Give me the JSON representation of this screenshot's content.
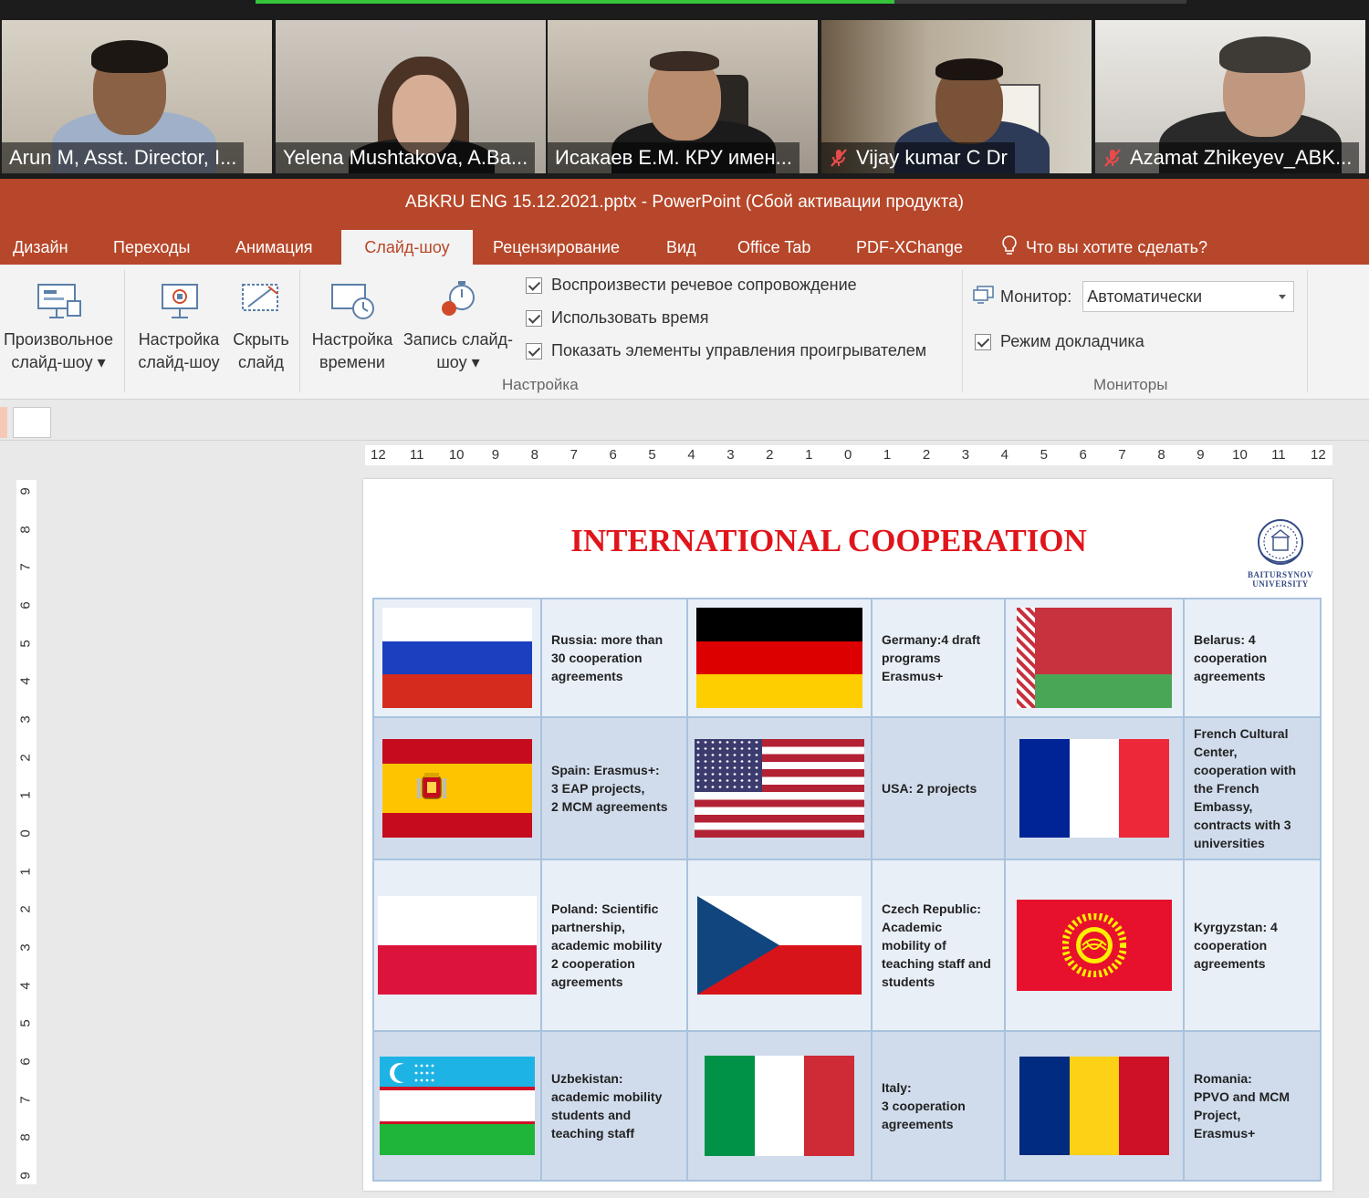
{
  "meeting": {
    "participants": [
      {
        "name": "Arun M, Asst. Director, I...",
        "muted": false
      },
      {
        "name": "Yelena Mushtakova, A.Ba...",
        "muted": false
      },
      {
        "name": "Исакаев Е.М. КРУ имен...",
        "muted": false
      },
      {
        "name": "Vijay kumar C Dr",
        "muted": true
      },
      {
        "name": "Azamat Zhikeyev_ABK...",
        "muted": true
      }
    ]
  },
  "window": {
    "title": "ABKRU ENG 15.12.2021.pptx  -  PowerPoint (Сбой активации продукта)"
  },
  "tabs": [
    {
      "label": "Дизайн"
    },
    {
      "label": "Переходы"
    },
    {
      "label": "Анимация"
    },
    {
      "label": "Слайд-шоу",
      "active": true
    },
    {
      "label": "Рецензирование"
    },
    {
      "label": "Вид"
    },
    {
      "label": "Office Tab"
    },
    {
      "label": "PDF-XChange"
    }
  ],
  "tell_me": "Что вы хотите сделать?",
  "ribbon": {
    "custom_show": {
      "line1": "Произвольное",
      "line2": "слайд-шоу ▾"
    },
    "setup_show": {
      "line1": "Настройка",
      "line2": "слайд-шоу"
    },
    "hide_slide": {
      "line1": "Скрыть",
      "line2": "слайд"
    },
    "rehearse": {
      "line1": "Настройка",
      "line2": "времени"
    },
    "record": {
      "line1": "Запись слайд-",
      "line2": "шоу ▾"
    },
    "checkboxes": [
      {
        "label": "Воспроизвести речевое сопровождение",
        "checked": true
      },
      {
        "label": "Использовать время",
        "checked": true
      },
      {
        "label": "Показать элементы управления проигрывателем",
        "checked": true
      }
    ],
    "group_setup": "Настройка",
    "monitor_label": "Монитор:",
    "monitor_value": "Автоматически",
    "presenter_view": {
      "label": "Режим докладчика",
      "checked": true
    },
    "group_monitors": "Мониторы"
  },
  "ruler": {
    "horizontal": [
      "12",
      "11",
      "10",
      "9",
      "8",
      "7",
      "6",
      "5",
      "4",
      "3",
      "2",
      "1",
      "0",
      "1",
      "2",
      "3",
      "4",
      "5",
      "6",
      "7",
      "8",
      "9",
      "10",
      "11",
      "12"
    ],
    "vertical": [
      "9",
      "8",
      "7",
      "6",
      "5",
      "4",
      "3",
      "2",
      "1",
      "0",
      "1",
      "2",
      "3",
      "4",
      "5",
      "6",
      "7",
      "8",
      "9"
    ]
  },
  "slide": {
    "title": "INTERNATIONAL COOPERATION",
    "logo_text": [
      "BAITURSYNOV",
      "UNIVERSITY"
    ],
    "rows": [
      [
        {
          "flag": "russia",
          "text": "Russia: more than\n30 cooperation\nagreements"
        },
        {
          "flag": "germany",
          "text": "Germany:4  draft\nprograms\nErasmus+"
        },
        {
          "flag": "belarus",
          "text": "Belarus: 4\ncooperation\nagreements"
        }
      ],
      [
        {
          "flag": "spain",
          "text": "Spain: Erasmus+:\n3 EAP projects,\n2 MCM agreements"
        },
        {
          "flag": "usa",
          "text": "USA: 2 projects"
        },
        {
          "flag": "france",
          "text": "French Cultural\nCenter,\ncooperation with\nthe French\nEmbassy,\ncontracts with 3\nuniversities"
        }
      ],
      [
        {
          "flag": "poland",
          "text": "Poland: Scientific\npartnership,\nacademic mobility\n2 cooperation\nagreements"
        },
        {
          "flag": "czech",
          "text": "Czech Republic:\nAcademic\nmobility of\nteaching staff and\nstudents"
        },
        {
          "flag": "kyrgyzstan",
          "text": "Kyrgyzstan:  4\ncooperation\nagreements"
        }
      ],
      [
        {
          "flag": "uzbekistan",
          "text": "Uzbekistan:\nacademic mobility\nstudents and\nteaching staff"
        },
        {
          "flag": "italy",
          "text": "Italy:\n3 cooperation\nagreements"
        },
        {
          "flag": "romania",
          "text": "Romania:\nPPVO and MCM\nProject,\nErasmus+"
        }
      ]
    ]
  },
  "colors": {
    "ppt_accent": "#b7472a",
    "title_red": "#e0151b",
    "table_border": "#a9c3de"
  }
}
